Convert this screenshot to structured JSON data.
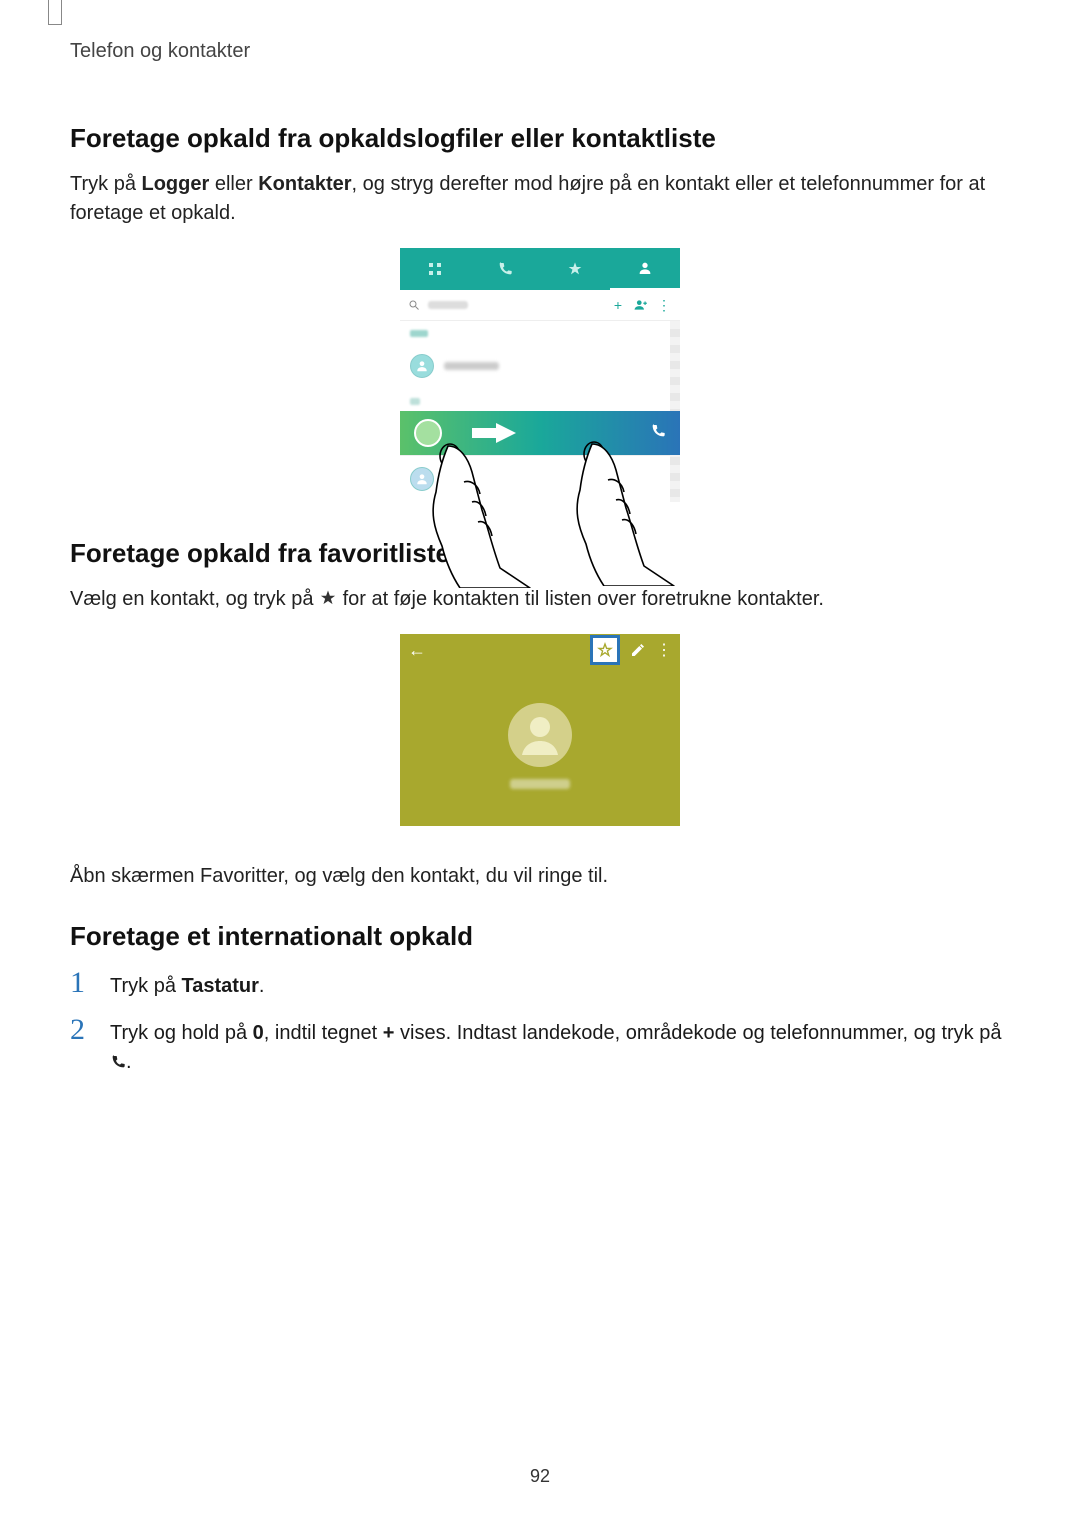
{
  "breadcrumb": "Telefon og kontakter",
  "section1": {
    "heading": "Foretage opkald fra opkaldslogfiler eller kontaktliste",
    "para_a": "Tryk på ",
    "para_b_bold": "Logger",
    "para_c": " eller ",
    "para_d_bold": "Kontakter",
    "para_e": ", og stryg derefter mod højre på en kontakt eller et telefonnummer for at foretage et opkald."
  },
  "section2": {
    "heading": "Foretage opkald fra favoritlisten",
    "para_a": "Vælg en kontakt, og tryk på ",
    "para_b": " for at føje kontakten til listen over foretrukne kontakter.",
    "followup": "Åbn skærmen Favoritter, og vælg den kontakt, du vil ringe til."
  },
  "section3": {
    "heading": "Foretage et internationalt opkald",
    "step1_a": "Tryk på ",
    "step1_b_bold": "Tastatur",
    "step1_c": ".",
    "step2_a": "Tryk og hold på ",
    "step2_b_bold": "0",
    "step2_c": ", indtil tegnet ",
    "step2_d_bold": "+",
    "step2_e": " vises. Indtast landekode, områdekode og telefonnummer, og tryk på ",
    "step2_f": "."
  },
  "page_number": "92",
  "step_numbers": {
    "one": "1",
    "two": "2"
  }
}
